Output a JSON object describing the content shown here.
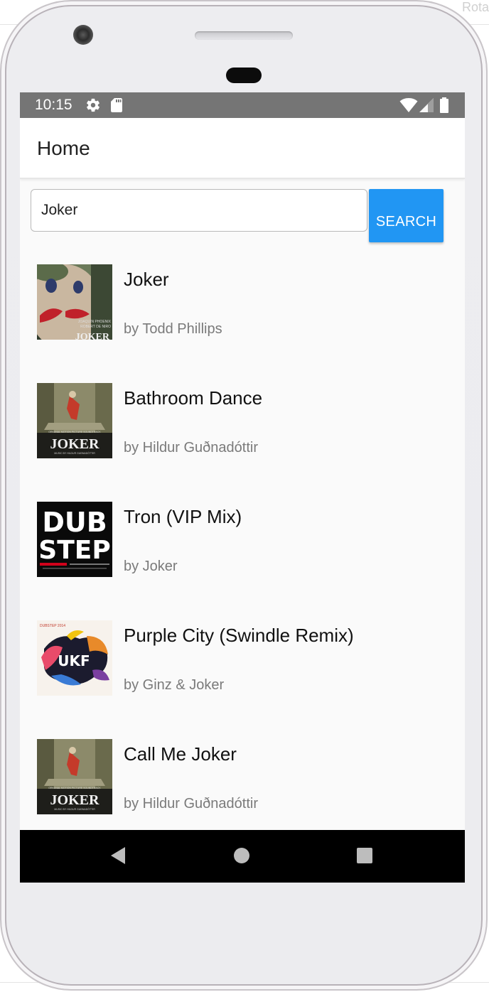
{
  "corner_label": "Rota",
  "status_bar": {
    "time": "10:15",
    "icons": [
      "gear-icon",
      "sd-card-icon",
      "wifi-icon",
      "signal-icon",
      "battery-icon"
    ]
  },
  "app_bar": {
    "title": "Home"
  },
  "search": {
    "value": "Joker",
    "button_label": "SEARCH"
  },
  "results": [
    {
      "title": "Joker",
      "artist": "by Todd Phillips",
      "cover": "joker-film-poster",
      "cover_text": [
        "JOAQUIN PHOENIX",
        "ROBERT DE NIRO",
        "JOKER"
      ]
    },
    {
      "title": "Bathroom Dance",
      "artist": "by Hildur Guðnadóttir",
      "cover": "joker-soundtrack-cover",
      "cover_text": [
        "ORIGINAL MOTION PICTURE SOUNDTRACK",
        "JOKER",
        "MUSIC BY HILDUR GUÐNADÓTTIR"
      ]
    },
    {
      "title": "Tron (VIP Mix)",
      "artist": "by Joker",
      "cover": "dubstep-cover",
      "cover_text": [
        "DUB",
        "STEP"
      ]
    },
    {
      "title": "Purple City (Swindle Remix)",
      "artist": "by Ginz & Joker",
      "cover": "ukf-cover",
      "cover_text": [
        "DUBSTEP 2014",
        "UKF"
      ]
    },
    {
      "title": "Call Me Joker",
      "artist": "by Hildur Guðnadóttir",
      "cover": "joker-soundtrack-cover",
      "cover_text": [
        "ORIGINAL MOTION PICTURE SOUNDTRACK",
        "JOKER",
        "MUSIC BY HILDUR GUÐNADÓTTIR"
      ]
    }
  ],
  "nav_bar": {
    "buttons": [
      "back-icon",
      "home-icon",
      "recents-icon"
    ]
  },
  "colors": {
    "status_bar": "#757575",
    "accent": "#2196f3",
    "nav_bar": "#000000",
    "artist_text": "#7a7a7a"
  }
}
